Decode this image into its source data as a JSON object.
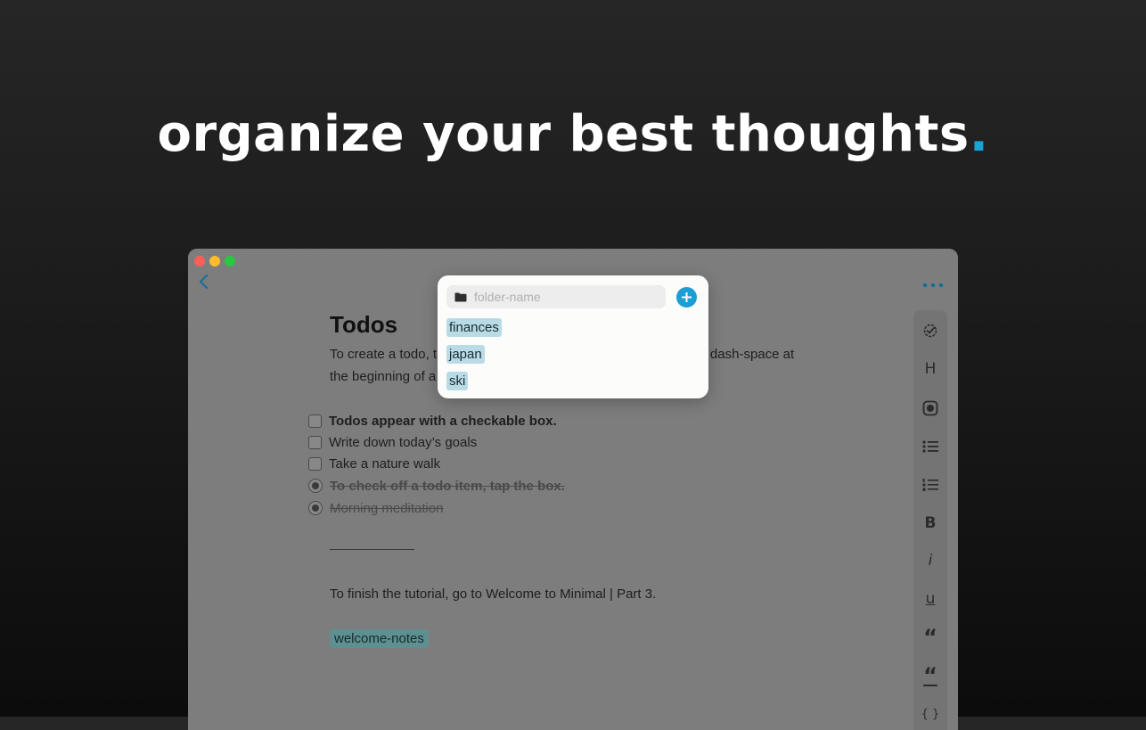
{
  "headline": {
    "text": "organize your best thoughts",
    "dot": ".",
    "dot_color": "#19a2d6"
  },
  "window": {
    "traffic_lights": [
      "close",
      "minimize",
      "zoom"
    ],
    "back_icon": "chevron-left-icon",
    "more_icon": "ellipsis-icon"
  },
  "note": {
    "title": "Todos",
    "paragraph": "To create a todo, tap the checkbox icon on the keyboard or type dash-space at the beginning of a line.",
    "todos": [
      {
        "text": "Todos appear with a checkable box.",
        "checked": false,
        "bold": true
      },
      {
        "text": "Write down today’s goals",
        "checked": false,
        "bold": false
      },
      {
        "text": "Take a nature walk",
        "checked": false,
        "bold": false
      },
      {
        "text": "To check off a todo item, tap the box.",
        "checked": true,
        "bold": true
      },
      {
        "text": "Morning meditation",
        "checked": true,
        "bold": false
      }
    ],
    "finish_text": "To finish the tutorial, go to Welcome to Minimal | Part 3.",
    "tag": "welcome-notes"
  },
  "toolbar": {
    "heading": "H",
    "bold": "B",
    "italic": "i",
    "underline": "u",
    "quote": "“",
    "blockquote": "“",
    "code": "{ }"
  },
  "folder_popup": {
    "placeholder": "folder-name",
    "value": "",
    "accent": "#1a9ed3",
    "folders": [
      "finances",
      "japan",
      "ski"
    ]
  }
}
